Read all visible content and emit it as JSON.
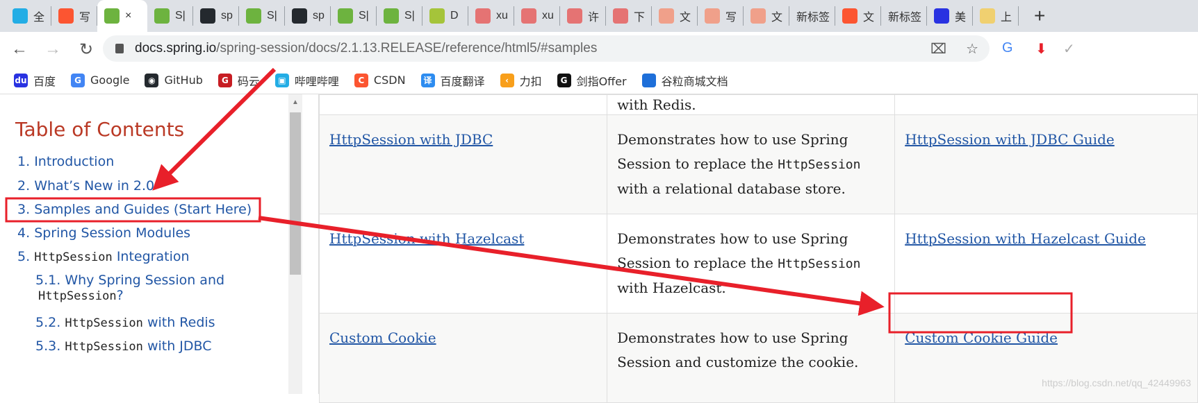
{
  "tabs": [
    {
      "icon": "bilibili-icon",
      "label": "全",
      "color": "#23ade5"
    },
    {
      "icon": "csdn-icon",
      "label": "写",
      "color": "#fc5531"
    },
    {
      "icon": "spring-icon",
      "label": "×",
      "color": "#6db33f",
      "active": true
    },
    {
      "icon": "spring-icon",
      "label": "S|",
      "color": "#6db33f"
    },
    {
      "icon": "github-icon",
      "label": "sp",
      "color": "#24292e"
    },
    {
      "icon": "spring-icon",
      "label": "S|",
      "color": "#6db33f"
    },
    {
      "icon": "github-icon",
      "label": "sp",
      "color": "#24292e"
    },
    {
      "icon": "spring-icon",
      "label": "S|",
      "color": "#6db33f"
    },
    {
      "icon": "spring-icon",
      "label": "S|",
      "color": "#6db33f"
    },
    {
      "icon": "spring-leaf-icon",
      "label": "D",
      "color": "#a5c43a"
    },
    {
      "icon": "gitee-icon",
      "label": "xu",
      "color": "#e57373"
    },
    {
      "icon": "gitee-icon",
      "label": "xu",
      "color": "#e57373"
    },
    {
      "icon": "gitee-icon",
      "label": "许",
      "color": "#e57373"
    },
    {
      "icon": "gitee-icon",
      "label": "下",
      "color": "#e57373"
    },
    {
      "icon": "csdn-icon",
      "label": "文",
      "color": "#f0a08a"
    },
    {
      "icon": "csdn-icon",
      "label": "写",
      "color": "#f0a08a"
    },
    {
      "icon": "csdn-icon",
      "label": "文",
      "color": "#f0a08a"
    },
    {
      "icon": "",
      "label": "新标签",
      "color": ""
    },
    {
      "icon": "csdn-icon",
      "label": "文",
      "color": "#fc5531"
    },
    {
      "icon": "",
      "label": "新标签",
      "color": ""
    },
    {
      "icon": "baidu-icon",
      "label": "美",
      "color": "#2932e1"
    },
    {
      "icon": "meituan-icon",
      "label": "上",
      "color": "#f0d070"
    }
  ],
  "address": {
    "host": "docs.spring.io",
    "path": "/spring-session/docs/2.1.13.RELEASE/reference/html5/#samples"
  },
  "bookmarks": [
    {
      "icon": "baidu-icon",
      "label": "百度",
      "color": "#2932e1",
      "glyph": "du"
    },
    {
      "icon": "google-icon",
      "label": "Google",
      "color": "#4285f4",
      "glyph": "G"
    },
    {
      "icon": "github-icon",
      "label": "GitHub",
      "color": "#24292e",
      "glyph": "◉"
    },
    {
      "icon": "gitee-icon",
      "label": "码云",
      "color": "#c71d23",
      "glyph": "G"
    },
    {
      "icon": "bilibili-icon",
      "label": "哔哩哔哩",
      "color": "#23ade5",
      "glyph": "▣"
    },
    {
      "icon": "csdn-icon",
      "label": "CSDN",
      "color": "#fc5531",
      "glyph": "C"
    },
    {
      "icon": "translate-icon",
      "label": "百度翻译",
      "color": "#2d8cf0",
      "glyph": "译"
    },
    {
      "icon": "leetcode-icon",
      "label": "力扣",
      "color": "#f89f1b",
      "glyph": "‹"
    },
    {
      "icon": "offer-icon",
      "label": "剑指Offer",
      "color": "#111",
      "glyph": "G"
    },
    {
      "icon": "doc-icon",
      "label": "谷粒商城文档",
      "color": "#1e6fd9",
      "glyph": "</>"
    }
  ],
  "toc": {
    "title": "Table of Contents",
    "items": [
      {
        "num": "1.",
        "text": "Introduction"
      },
      {
        "num": "2.",
        "text": "What’s New in 2.0"
      },
      {
        "num": "3.",
        "text": "Samples and Guides (Start Here)"
      },
      {
        "num": "4.",
        "text": "Spring Session Modules"
      },
      {
        "num": "5.",
        "code": "HttpSession",
        "text": "Integration"
      },
      {
        "num": "5.1.",
        "text": "Why Spring Session and",
        "code2": "HttpSession",
        "tail": "?"
      },
      {
        "num": "5.2.",
        "code": "HttpSession",
        "text": "with Redis"
      },
      {
        "num": "5.3.",
        "code": "HttpSession",
        "text": "with JDBC"
      }
    ]
  },
  "table": {
    "partial_text": "with Redis.",
    "rows": [
      {
        "sample": "HttpSession with JDBC",
        "desc1": "Demonstrates how to use Spring Session to replace the ",
        "code": "HttpSession",
        "desc2": " with a relational database store.",
        "guide": "HttpSession with JDBC Guide"
      },
      {
        "sample": "HttpSession with Hazelcast",
        "desc1": "Demonstrates how to use Spring Session to replace the ",
        "code": "HttpSession",
        "desc2": " with Hazelcast.",
        "guide": "HttpSession with Hazelcast Guide"
      },
      {
        "sample": "Custom Cookie",
        "desc1": "Demonstrates how to use Spring Session and customize the cookie.",
        "code": "",
        "desc2": "",
        "guide": "Custom Cookie Guide"
      }
    ]
  },
  "watermark": "https://blog.csdn.net/qq_42449963",
  "annotation_color": "#e8202a"
}
